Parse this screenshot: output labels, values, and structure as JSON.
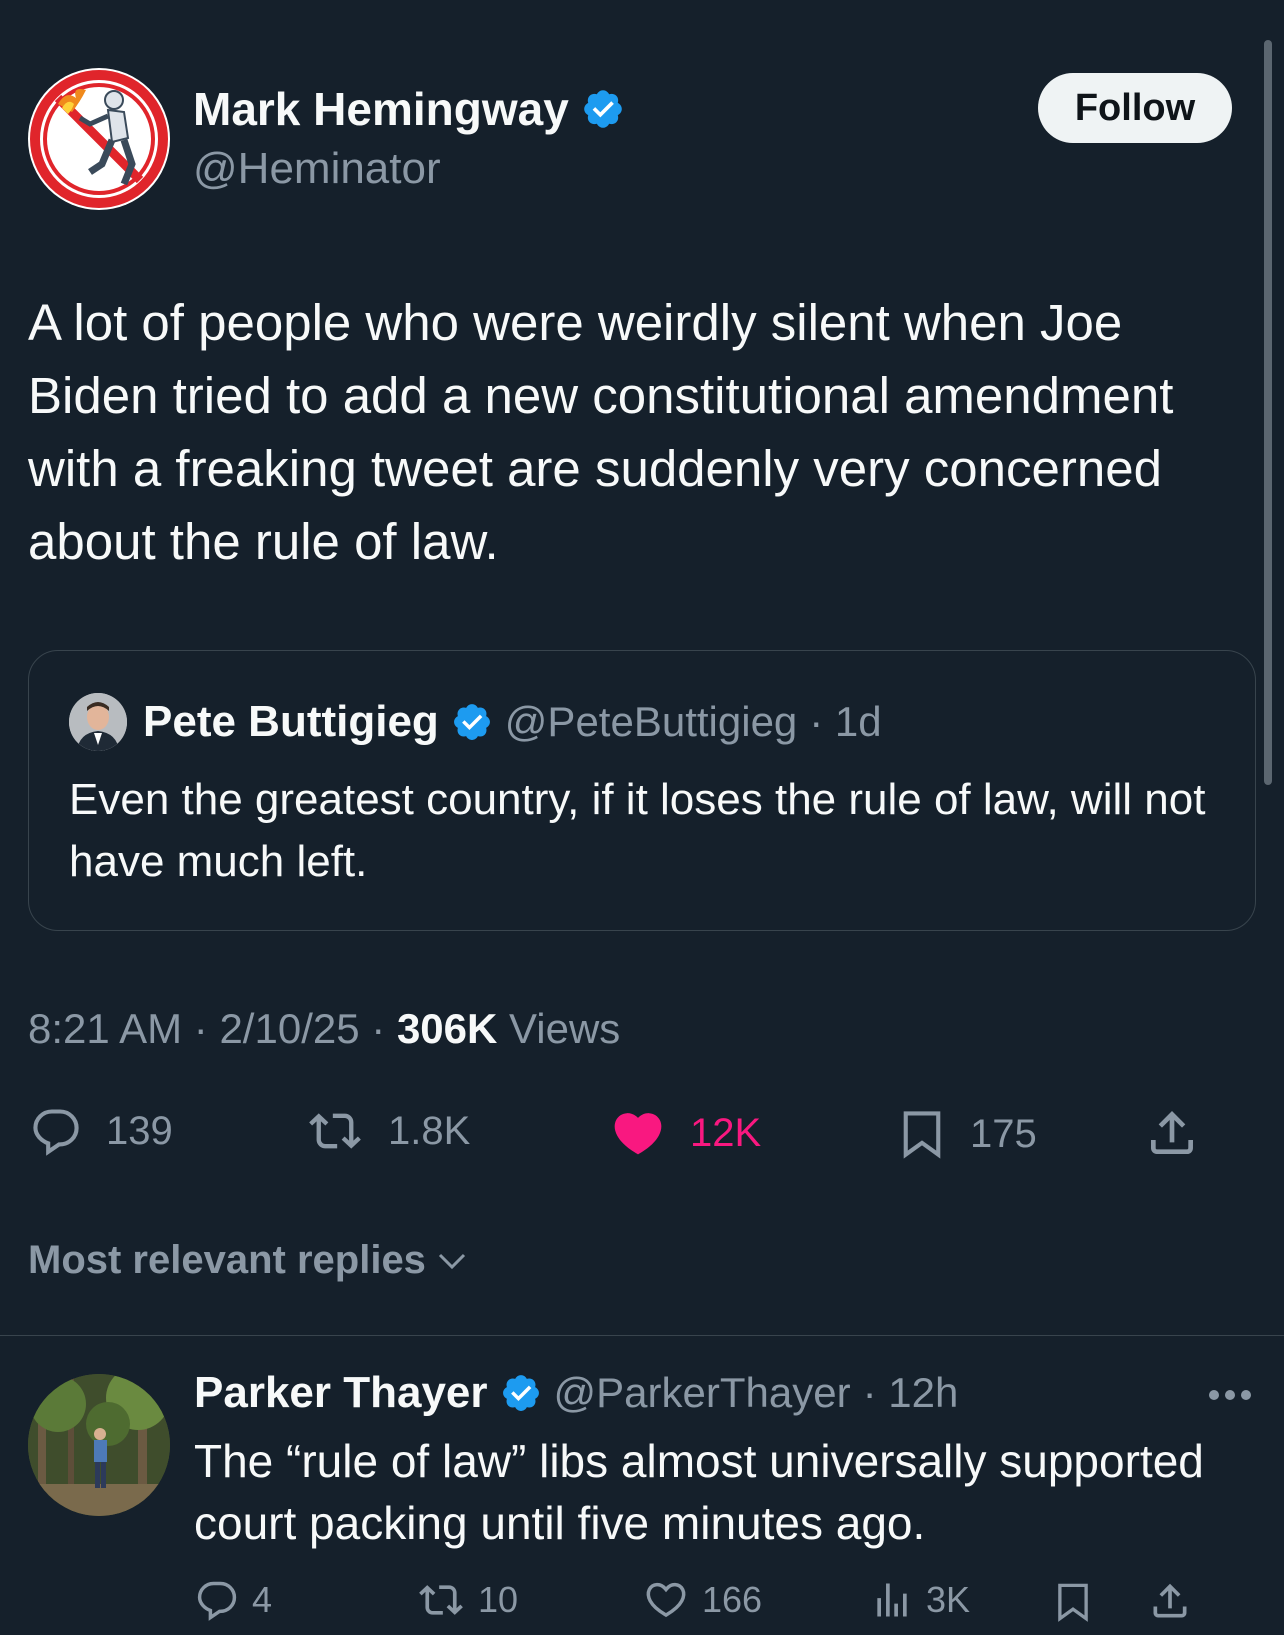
{
  "tweet": {
    "author_name": "Mark Hemingway",
    "author_handle": "@Heminator",
    "follow_label": "Follow",
    "text": "A lot of people who were weirdly silent when Joe Biden tried to add a new constitutional amendment with a freaking tweet are suddenly very concerned about the rule of law.",
    "time": "8:21 AM",
    "date": "2/10/25",
    "separator": "·",
    "views_count": "306K",
    "views_label": "Views",
    "replies": "139",
    "reposts": "1.8K",
    "likes": "12K",
    "bookmarks": "175"
  },
  "quote": {
    "name": "Pete Buttigieg",
    "handle": "@PeteButtigieg",
    "age": "· 1d",
    "text": "Even the greatest country, if it loses the rule of law, will not have much left."
  },
  "sort": {
    "label": "Most relevant replies"
  },
  "reply": {
    "name": "Parker Thayer",
    "handle": "@ParkerThayer",
    "age": "· 12h",
    "text": "The “rule of law” libs almost universally supported court packing until five minutes ago.",
    "replies": "4",
    "reposts": "10",
    "likes": "166",
    "views": "3K"
  },
  "colors": {
    "background": "#15202b",
    "verified": "#1d9bf0",
    "like": "#f91880",
    "muted": "#8b98a5"
  },
  "icons": [
    "verified-badge-icon",
    "reply-icon",
    "repost-icon",
    "heart-filled-icon",
    "bookmark-icon",
    "share-icon",
    "chevron-down-icon",
    "more-icon",
    "heart-icon",
    "views-icon"
  ]
}
